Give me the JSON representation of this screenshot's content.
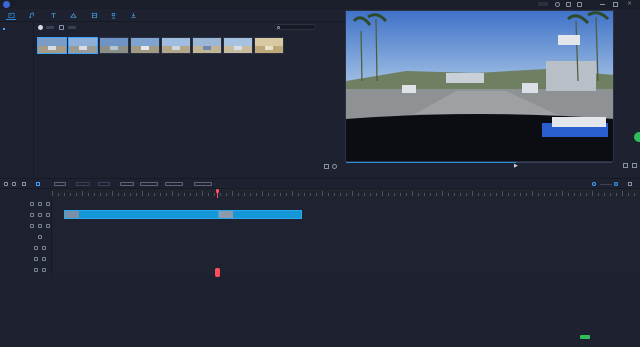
{
  "app": {
    "title_items": [
      "",
      "",
      ""
    ],
    "brand_color": "#3a66d8",
    "accent_color": "#2e8fd8",
    "playhead_color": "#ff4d5a"
  },
  "toolbar": {
    "tools": [
      {
        "icon": "media-icon",
        "active": true
      },
      {
        "icon": "audio-icon",
        "active": false
      },
      {
        "icon": "text-icon",
        "active": false
      },
      {
        "icon": "transition-icon",
        "active": false
      },
      {
        "icon": "effects-icon",
        "active": false
      },
      {
        "icon": "elements-icon",
        "active": false
      },
      {
        "icon": "export-icon",
        "active": false
      }
    ]
  },
  "leftnav": {
    "items": [
      {
        "label": "",
        "active": true
      },
      {
        "label": "",
        "active": false
      },
      {
        "label": "",
        "active": false
      }
    ]
  },
  "media": {
    "search_placeholder": "",
    "clips": [
      {
        "caption": "",
        "selected": true
      },
      {
        "caption": "",
        "selected": true
      },
      {
        "caption": "",
        "selected": false
      },
      {
        "caption": "",
        "selected": false
      },
      {
        "caption": "",
        "selected": false
      },
      {
        "caption": "",
        "selected": false
      },
      {
        "caption": "",
        "selected": false
      },
      {
        "caption": "",
        "selected": false
      }
    ]
  },
  "preview": {
    "progress": 0.64,
    "time_current": "",
    "time_total": ""
  },
  "timeline": {
    "tracks": [
      {
        "label": "",
        "kind": "video"
      },
      {
        "label": "",
        "kind": "video-main"
      },
      {
        "label": "",
        "kind": "pip"
      },
      {
        "label": "",
        "kind": "text"
      },
      {
        "label": "",
        "kind": "audio"
      },
      {
        "label": "",
        "kind": "music"
      },
      {
        "label": "",
        "kind": "voice"
      }
    ],
    "clips": [
      {
        "caption": ""
      },
      {
        "caption": ""
      }
    ]
  },
  "status": {
    "text": ""
  }
}
